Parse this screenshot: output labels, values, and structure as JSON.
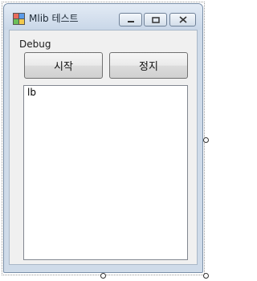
{
  "window": {
    "title": "Mlib 테스트",
    "controls": {
      "minimize_icon": "minimize-icon",
      "maximize_icon": "maximize-icon",
      "close_icon": "close-icon"
    }
  },
  "main": {
    "label": "Debug",
    "start_button": "시작",
    "stop_button": "정지",
    "listbox": {
      "items": [
        "lb"
      ]
    }
  },
  "colors": {
    "titlebar": "#c9d7e8",
    "client_bg": "#f0f0f0",
    "listbox_bg": "#ffffff"
  }
}
